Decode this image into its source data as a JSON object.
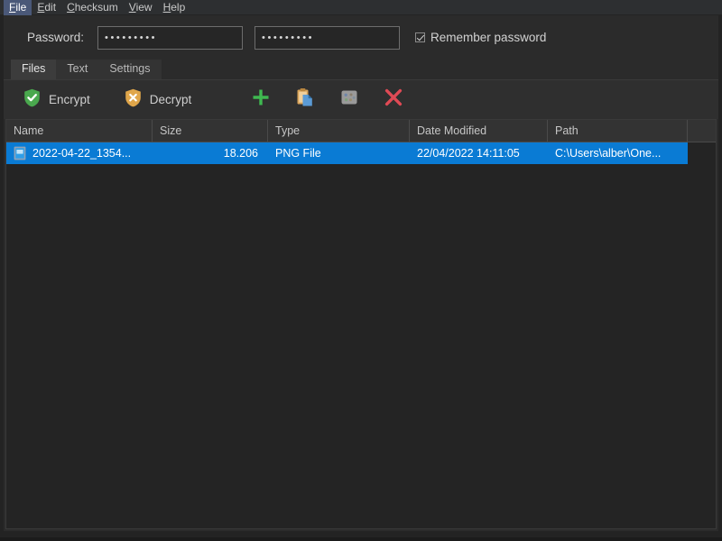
{
  "menubar": {
    "items": [
      {
        "label": "File",
        "mnemonic": "F",
        "rest": "ile",
        "active": true
      },
      {
        "label": "Edit",
        "mnemonic": "E",
        "rest": "dit",
        "active": false
      },
      {
        "label": "Checksum",
        "mnemonic": "C",
        "rest": "hecksum",
        "active": false
      },
      {
        "label": "View",
        "mnemonic": "V",
        "rest": "iew",
        "active": false
      },
      {
        "label": "Help",
        "mnemonic": "H",
        "rest": "elp",
        "active": false
      }
    ]
  },
  "password": {
    "label": "Password:",
    "field1_value": "•••••••••",
    "field1_placeholder": "",
    "field2_value": "•••••••••",
    "field2_placeholder": "",
    "remember_label": "Remember password",
    "remember_checked": true
  },
  "tabs": [
    {
      "label": "Files",
      "active": true
    },
    {
      "label": "Text",
      "active": false
    },
    {
      "label": "Settings",
      "active": false
    }
  ],
  "toolbar": {
    "encrypt_label": "Encrypt",
    "encrypt_icon": "shield-check-icon",
    "decrypt_label": "Decrypt",
    "decrypt_icon": "shield-x-icon",
    "add_icon": "plus-icon",
    "paste_icon": "clipboard-paste-icon",
    "grid_icon": "grid-disabled-icon",
    "remove_icon": "red-x-icon"
  },
  "file_list": {
    "columns": [
      "Name",
      "Size",
      "Type",
      "Date Modified",
      "Path",
      ""
    ],
    "rows": [
      {
        "name": "2022-04-22_1354...",
        "size": "18.206",
        "type": "PNG File",
        "date_modified": "22/04/2022 14:11:05",
        "path": "C:\\Users\\alber\\One...",
        "selected": true,
        "icon": "image-file-icon"
      }
    ]
  },
  "colors": {
    "selection": "#0a7bd4",
    "menu_highlight": "#4a5878",
    "encrypt_green": "#4aa84e",
    "decrypt_amber": "#e0a64a",
    "plus_green": "#3fb950",
    "remove_red": "#e04a55",
    "window_bg": "#2b2b2b",
    "list_bg": "#242424"
  }
}
